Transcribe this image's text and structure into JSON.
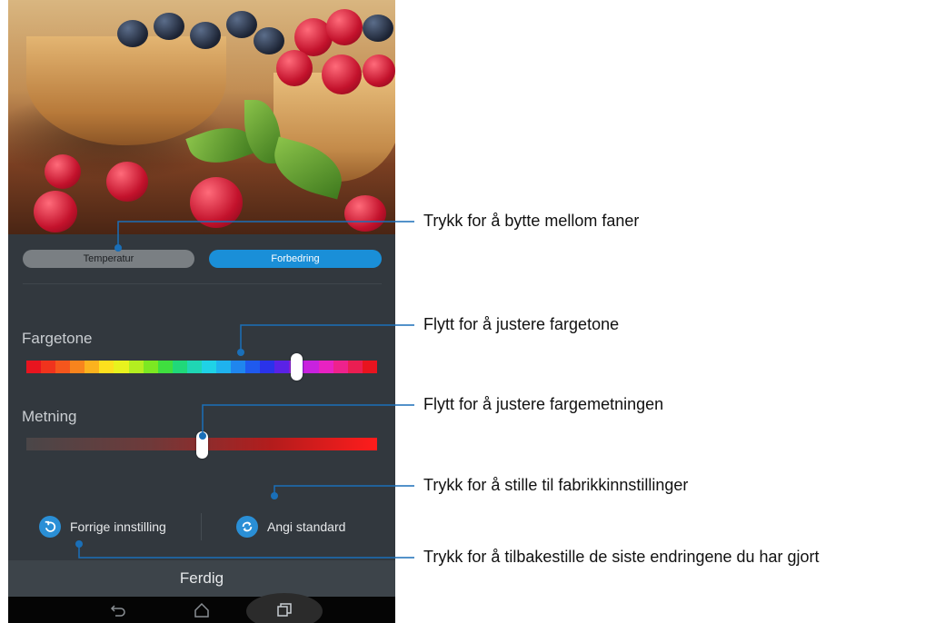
{
  "tabs": {
    "left": "Temperatur",
    "right": "Forbedring"
  },
  "sliders": [
    {
      "label": "Fargetone",
      "value_fraction": 0.77
    },
    {
      "label": "Metning",
      "value_fraction": 0.5
    }
  ],
  "bottom_actions": {
    "previous": "Forrige innstilling",
    "default": "Angi standard"
  },
  "done_label": "Ferdig",
  "callouts": [
    "Trykk for å bytte mellom faner",
    "Flytt for å justere fargetone",
    "Flytt for å justere fargemetningen",
    "Trykk for å stille til fabrikkinnstillinger",
    "Trykk for å tilbakestille de siste endringene du har gjort"
  ],
  "colors": {
    "accent": "#1a8fd8",
    "panel": "#32383e",
    "callout_line": "#1a6fb8"
  },
  "icons": [
    "undo-icon",
    "refresh-icon",
    "back-icon",
    "home-icon",
    "recent-apps-icon"
  ]
}
